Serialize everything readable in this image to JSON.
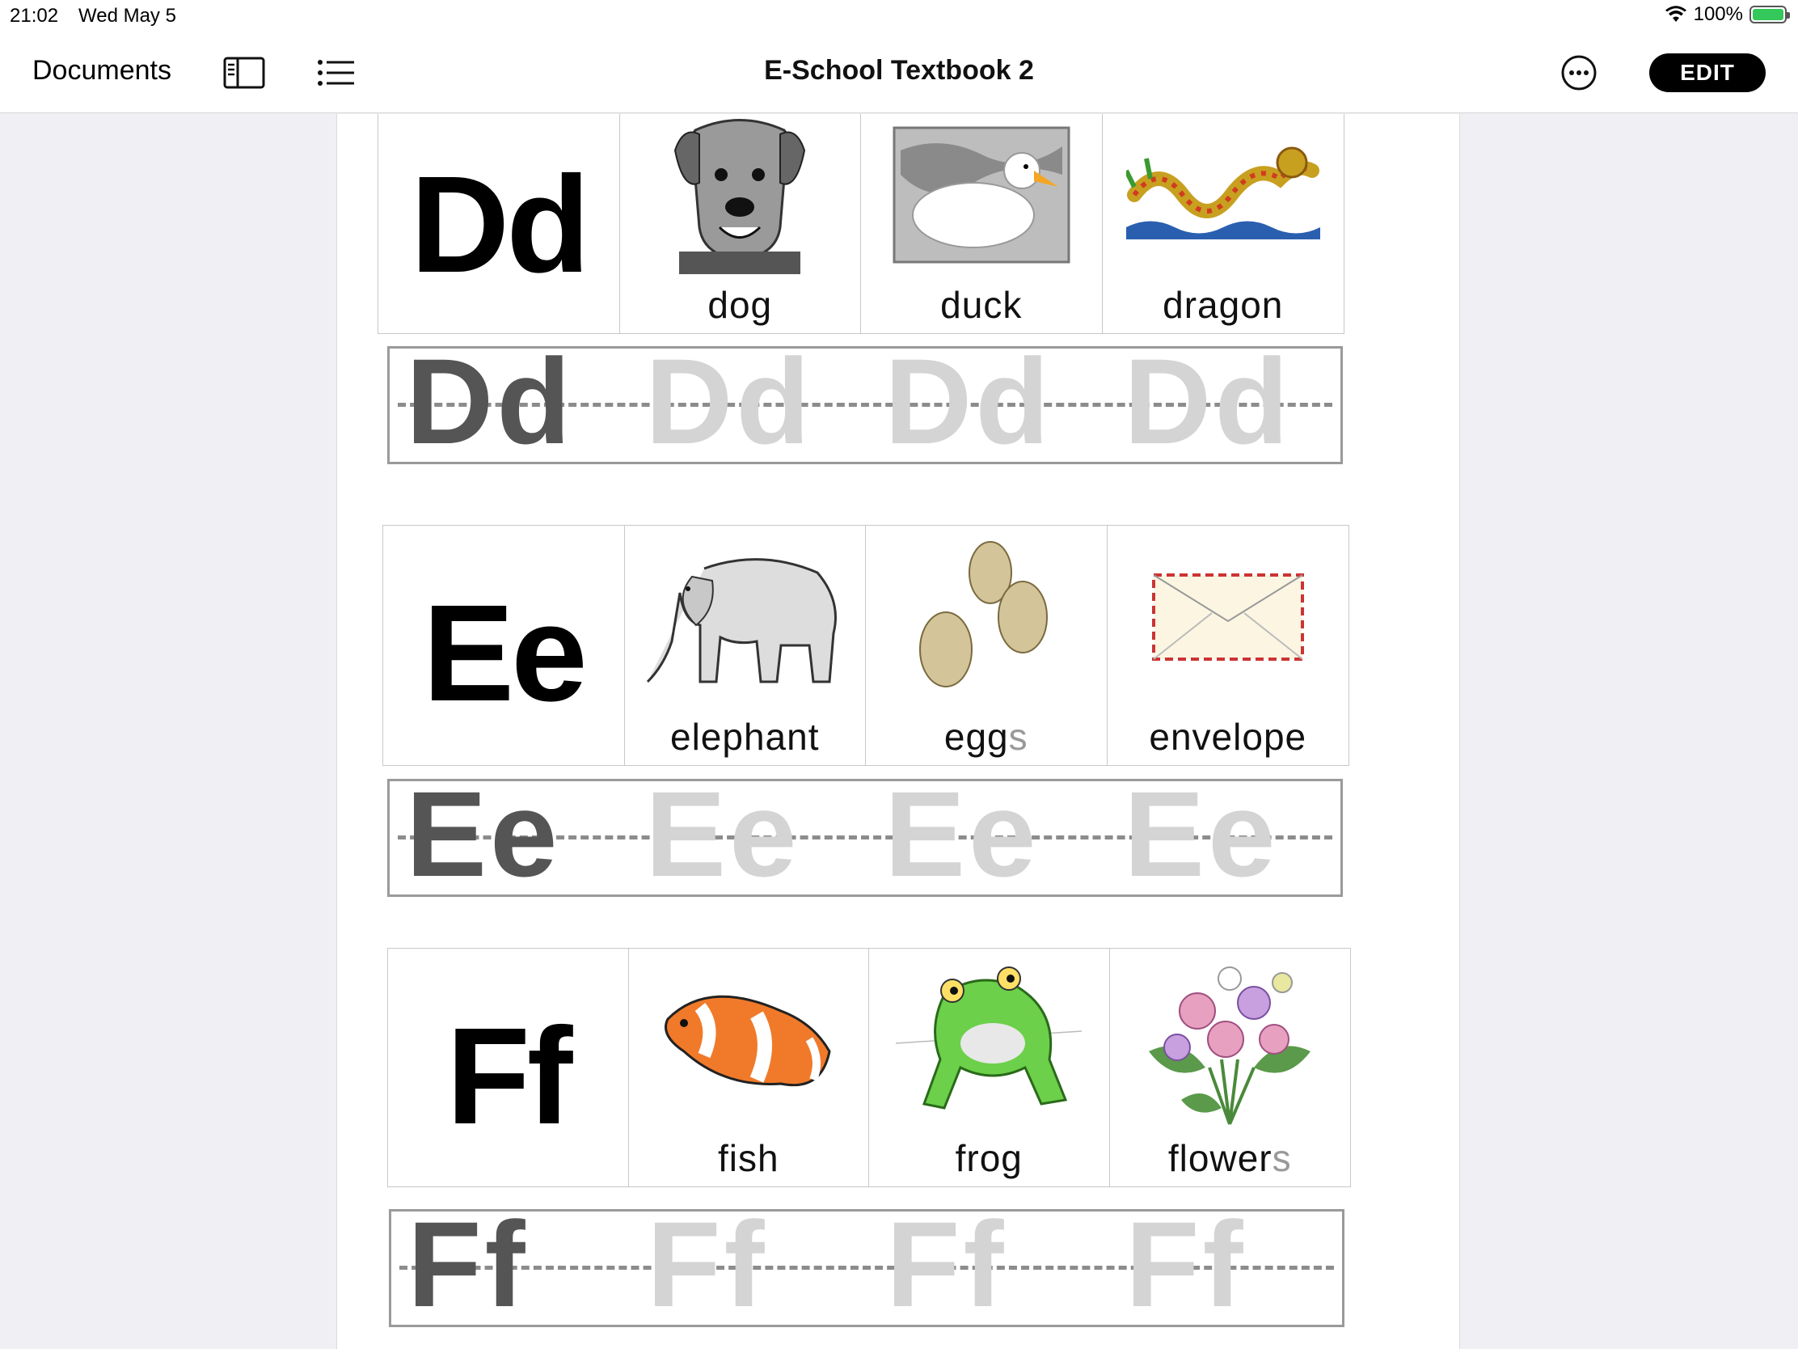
{
  "status": {
    "time": "21:02",
    "date": "Wed May 5",
    "battery": "100%"
  },
  "nav": {
    "documents": "Documents",
    "title": "E-School Textbook 2",
    "edit": "EDIT"
  },
  "sections": [
    {
      "letter": "Dd",
      "words": [
        {
          "main": "dog",
          "faint": ""
        },
        {
          "main": "duck",
          "faint": ""
        },
        {
          "main": "dragon",
          "faint": ""
        }
      ],
      "trace": "Dd"
    },
    {
      "letter": "Ee",
      "words": [
        {
          "main": "elephant",
          "faint": ""
        },
        {
          "main": "egg",
          "faint": "s"
        },
        {
          "main": "envelope",
          "faint": ""
        }
      ],
      "trace": "Ee"
    },
    {
      "letter": "Ff",
      "words": [
        {
          "main": "fish",
          "faint": ""
        },
        {
          "main": "frog",
          "faint": ""
        },
        {
          "main": "flower",
          "faint": "s"
        }
      ],
      "trace": "Ff"
    }
  ],
  "icons": [
    "wifi-icon",
    "battery-icon",
    "sidebar-icon",
    "list-icon",
    "more-icon",
    "dog-picture",
    "duck-picture",
    "dragon-picture",
    "elephant-picture",
    "eggs-picture",
    "envelope-picture",
    "fish-picture",
    "frog-picture",
    "flowers-picture"
  ]
}
